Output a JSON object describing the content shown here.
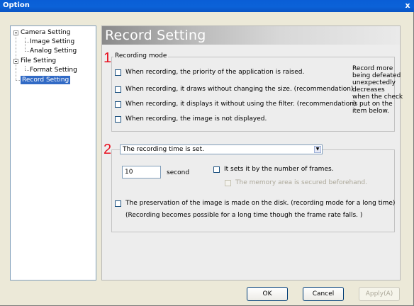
{
  "window": {
    "title": "Option",
    "close_glyph": "x"
  },
  "tree": {
    "camera_setting": "Camera Setting",
    "image_setting": "Image Setting",
    "analog_setting": "Analog Setting",
    "file_setting": "File Setting",
    "format_setting": "Format Setting",
    "record_setting": "Record Setting",
    "selected": "Record Setting"
  },
  "panel": {
    "title": "Record Setting",
    "step_1": "1",
    "step_2": "2"
  },
  "recording_mode": {
    "legend": "Recording mode",
    "options": [
      "When recording, the priority of the application is raised.",
      "When recording, it draws without changing the size. (recommendation)",
      "When recording, it displays it without using the filter. (recommendation)",
      "When recording, the image is not displayed."
    ],
    "note_lines": [
      "Record more",
      "being defeated",
      "unexpectedly",
      "decreases",
      "when the check",
      "is put on the",
      "item below."
    ]
  },
  "recording_time": {
    "select_value": "The recording time is set.",
    "time_value": "10",
    "time_unit": "second",
    "frames_label": "It sets it by the number of frames.",
    "memory_label": "The memory area is secured beforehand.",
    "disk_label": "The preservation of the image is made on the disk. (recording mode for a long time)",
    "disk_note": "(Recording becomes possible for a long time though the frame rate falls. )"
  },
  "buttons": {
    "ok": "OK",
    "cancel": "Cancel",
    "apply": "Apply(A)"
  },
  "colors": {
    "titlebar": "#0a5ed6",
    "selection": "#316ac5",
    "step_number": "#e8101e"
  },
  "icons": {
    "expand": "minus-box-icon",
    "checkbox": "checkbox-icon",
    "dropdown": "chevron-down-icon"
  }
}
